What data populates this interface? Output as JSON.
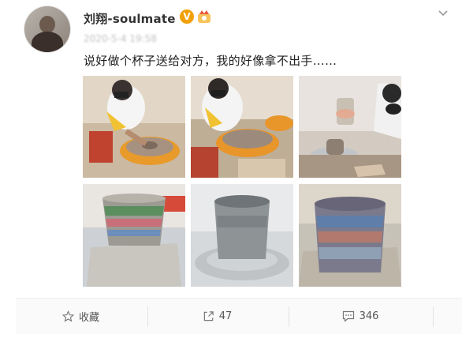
{
  "user": {
    "name": "刘翔-soulmate",
    "verified_badge": "V",
    "timestamp": "2020-5-4 19:58"
  },
  "post": {
    "text": "说好做个杯子送给对方，我的好像拿不出手……"
  },
  "photos": [
    {
      "icon": "pottery-wheel-photo"
    },
    {
      "icon": "pottery-wheel-photo"
    },
    {
      "icon": "pottery-shaping-photo"
    },
    {
      "icon": "striped-cup-photo"
    },
    {
      "icon": "grey-cup-photo"
    },
    {
      "icon": "striped-cup-photo"
    }
  ],
  "actions": {
    "favorite_label": "收藏",
    "repost_count": "47",
    "comment_count": "346"
  },
  "colors": {
    "verified": "#f2a007",
    "username": "#333333",
    "text": "#222222",
    "meta": "#555555"
  }
}
